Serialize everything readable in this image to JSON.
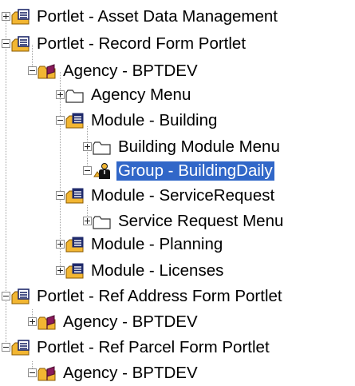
{
  "tree": {
    "nodes": [
      {
        "label": "Portlet - Asset Data Management",
        "icon": "portlet-form-icon",
        "expanded": false
      },
      {
        "label": "Portlet - Record Form Portlet",
        "icon": "portlet-form-icon",
        "expanded": true
      },
      {
        "label": "Agency - BPTDEV",
        "icon": "agency-folder-icon",
        "expanded": true
      },
      {
        "label": "Agency Menu",
        "icon": "folder-icon",
        "expanded": false
      },
      {
        "label": "Module - Building",
        "icon": "module-form-icon",
        "expanded": true
      },
      {
        "label": "Building Module Menu",
        "icon": "folder-icon",
        "expanded": false
      },
      {
        "label": "Group - BuildingDaily",
        "icon": "user-group-icon",
        "expanded": true,
        "selected": true
      },
      {
        "label": "Module - ServiceRequest",
        "icon": "module-form-icon",
        "expanded": true
      },
      {
        "label": "Service Request Menu",
        "icon": "folder-icon",
        "expanded": false
      },
      {
        "label": "Module - Planning",
        "icon": "module-form-icon",
        "expanded": false
      },
      {
        "label": "Module - Licenses",
        "icon": "module-form-icon",
        "expanded": false
      },
      {
        "label": "Portlet - Ref Address Form Portlet",
        "icon": "portlet-form-icon",
        "expanded": true
      },
      {
        "label": "Agency - BPTDEV",
        "icon": "agency-folder-icon",
        "expanded": false
      },
      {
        "label": "Portlet - Ref Parcel Form Portlet",
        "icon": "portlet-form-icon",
        "expanded": true
      },
      {
        "label": "Agency - BPTDEV",
        "icon": "agency-folder-icon",
        "expanded": true
      }
    ]
  },
  "colors": {
    "selection": "#3167c8",
    "folder_yellow": "#f2b632",
    "form_navy": "#1f2a6b"
  }
}
